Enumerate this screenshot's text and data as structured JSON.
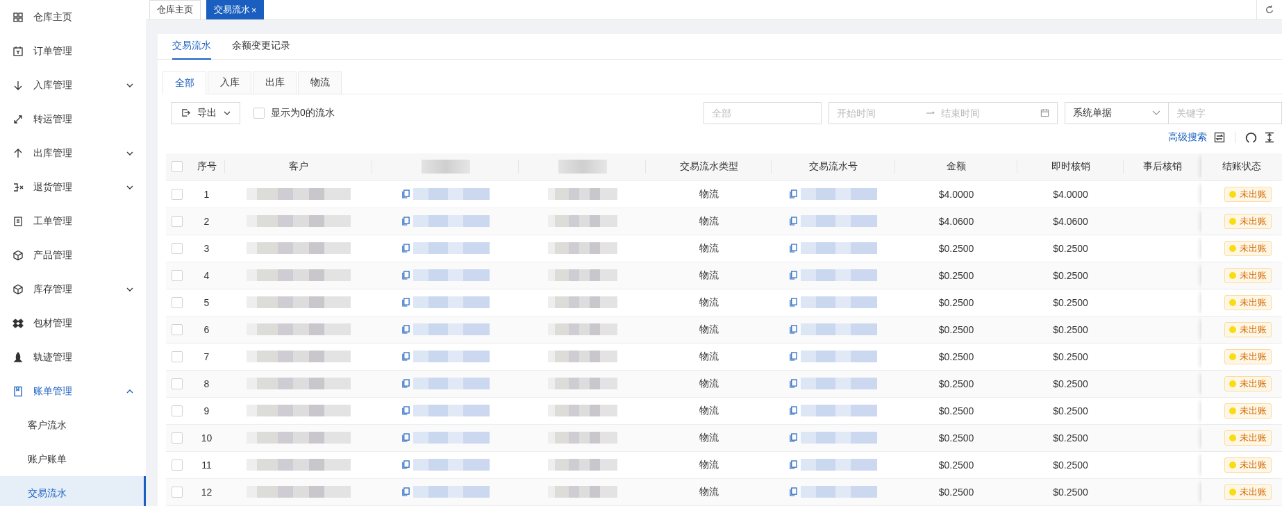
{
  "sidebar": {
    "items": [
      {
        "label": "仓库主页",
        "kind": "link",
        "selected": false
      },
      {
        "label": "订单管理",
        "kind": "link",
        "selected": false
      },
      {
        "label": "入库管理",
        "kind": "group",
        "expanded": false,
        "selected": false
      },
      {
        "label": "转运管理",
        "kind": "link",
        "selected": false
      },
      {
        "label": "出库管理",
        "kind": "group",
        "expanded": false,
        "selected": false
      },
      {
        "label": "退货管理",
        "kind": "group",
        "expanded": false,
        "selected": false
      },
      {
        "label": "工单管理",
        "kind": "link",
        "selected": false
      },
      {
        "label": "产品管理",
        "kind": "link",
        "selected": false
      },
      {
        "label": "库存管理",
        "kind": "group",
        "expanded": false,
        "selected": false
      },
      {
        "label": "包材管理",
        "kind": "link",
        "selected": false
      },
      {
        "label": "轨迹管理",
        "kind": "link",
        "selected": false
      },
      {
        "label": "账单管理",
        "kind": "group",
        "expanded": true,
        "selected": true,
        "children": [
          {
            "label": "客户流水",
            "selected": false
          },
          {
            "label": "账户账单",
            "selected": false
          },
          {
            "label": "交易流水",
            "selected": true
          }
        ]
      }
    ]
  },
  "page_tabs": [
    {
      "label": "仓库主页",
      "selected": false
    },
    {
      "label": "交易流水",
      "selected": true,
      "close": "×"
    }
  ],
  "main_tabs": [
    {
      "label": "交易流水",
      "selected": true
    },
    {
      "label": "余额变更记录",
      "selected": false
    }
  ],
  "sub_tabs": [
    {
      "label": "全部",
      "selected": true
    },
    {
      "label": "入库",
      "selected": false
    },
    {
      "label": "出库",
      "selected": false
    },
    {
      "label": "物流",
      "selected": false
    }
  ],
  "toolbar": {
    "export_button": "导出",
    "show_zero": {
      "label": "显示为0的流水",
      "checked": false
    },
    "type_select": {
      "placeholder": "全部"
    },
    "date_range": {
      "start_placeholder": "开始时间",
      "end_placeholder": "结束时间"
    },
    "document_select": {
      "value": "系统单据"
    },
    "keyword": {
      "placeholder": "关键字"
    },
    "advanced_search": "高级搜索"
  },
  "table": {
    "header_checked": false,
    "columns": [
      {
        "label": "序号",
        "kind": "text"
      },
      {
        "label": "客户",
        "kind": "redacted"
      },
      {
        "kind": "copy",
        "obscured": true
      },
      {
        "kind": "redacted",
        "obscured": true
      },
      {
        "label": "交易流水类型",
        "kind": "text"
      },
      {
        "label": "交易流水号",
        "kind": "copy"
      },
      {
        "label": "金额",
        "kind": "text"
      },
      {
        "label": "即时核销",
        "kind": "text"
      },
      {
        "label": "事后核销",
        "kind": "text"
      },
      {
        "label": "结账状态",
        "kind": "status"
      }
    ],
    "rows": [
      {
        "checked": false,
        "index": "1",
        "type": "物流",
        "amount": "$4.0000",
        "instant": "$4.0000",
        "status": "未出账"
      },
      {
        "checked": false,
        "index": "2",
        "type": "物流",
        "amount": "$4.0600",
        "instant": "$4.0600",
        "status": "未出账"
      },
      {
        "checked": false,
        "index": "3",
        "type": "物流",
        "amount": "$0.2500",
        "instant": "$0.2500",
        "status": "未出账"
      },
      {
        "checked": false,
        "index": "4",
        "type": "物流",
        "amount": "$0.2500",
        "instant": "$0.2500",
        "status": "未出账"
      },
      {
        "checked": false,
        "index": "5",
        "type": "物流",
        "amount": "$0.2500",
        "instant": "$0.2500",
        "status": "未出账"
      },
      {
        "checked": false,
        "index": "6",
        "type": "物流",
        "amount": "$0.2500",
        "instant": "$0.2500",
        "status": "未出账"
      },
      {
        "checked": false,
        "index": "7",
        "type": "物流",
        "amount": "$0.2500",
        "instant": "$0.2500",
        "status": "未出账"
      },
      {
        "checked": false,
        "index": "8",
        "type": "物流",
        "amount": "$0.2500",
        "instant": "$0.2500",
        "status": "未出账"
      },
      {
        "checked": false,
        "index": "9",
        "type": "物流",
        "amount": "$0.2500",
        "instant": "$0.2500",
        "status": "未出账"
      },
      {
        "checked": false,
        "index": "10",
        "type": "物流",
        "amount": "$0.2500",
        "instant": "$0.2500",
        "status": "未出账"
      },
      {
        "checked": false,
        "index": "11",
        "type": "物流",
        "amount": "$0.2500",
        "instant": "$0.2500",
        "status": "未出账"
      },
      {
        "checked": false,
        "index": "12",
        "type": "物流",
        "amount": "$0.2500",
        "instant": "$0.2500",
        "status": "未出账"
      }
    ]
  }
}
